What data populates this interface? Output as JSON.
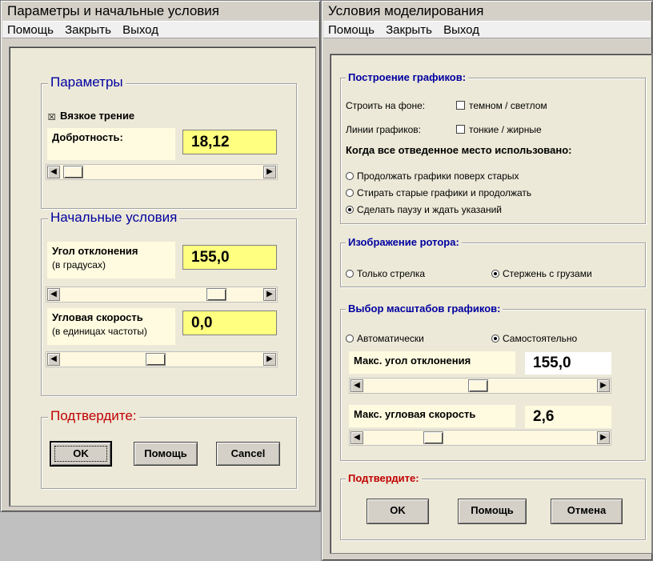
{
  "left": {
    "title": "Параметры и начальные условия",
    "menu": [
      "Помощь",
      "Закрыть",
      "Выход"
    ],
    "params": {
      "legend": "Параметры",
      "viscous_label": "Вязкое трение",
      "viscous_checked": true,
      "q_label": "Добротность:",
      "q_value": "18,12"
    },
    "initial": {
      "legend": "Начальные условия",
      "angle_label": "Угол отклонения",
      "angle_sub": "(в градусах)",
      "angle_value": "155,0",
      "speed_label": "Угловая скорость",
      "speed_sub": "(в единицах частоты)",
      "speed_value": "0,0"
    },
    "confirm": {
      "legend": "Подтвердите:",
      "ok": "OK",
      "help": "Помощь",
      "cancel": "Cancel"
    }
  },
  "right": {
    "title": "Условия моделирования",
    "menu": [
      "Помощь",
      "Закрыть",
      "Выход"
    ],
    "plots": {
      "legend": "Построение графиков:",
      "bg_label": "Строить на фоне:",
      "bg_option": "темном / светлом",
      "lines_label": "Линии графиков:",
      "lines_option": "тонкие /  жирные",
      "when_full": "Когда все отведенное место использовано:",
      "options": [
        {
          "label": "Продолжать графики поверх старых",
          "selected": false
        },
        {
          "label": "Стирать старые графики и продолжать",
          "selected": false
        },
        {
          "label": "Сделать паузу и ждать указаний",
          "selected": true
        }
      ]
    },
    "rotor": {
      "legend": "Изображение ротора:",
      "options": [
        {
          "label": "Только стрелка",
          "selected": false
        },
        {
          "label": "Стержень с грузами",
          "selected": true
        }
      ]
    },
    "scales": {
      "legend": "Выбор масштабов графиков:",
      "options": [
        {
          "label": "Автоматически",
          "selected": false
        },
        {
          "label": "Самостоятельно",
          "selected": true
        }
      ],
      "max_angle_label": "Макс. угол отклонения",
      "max_angle_value": "155,0",
      "max_speed_label": "Макс. угловая скорость",
      "max_speed_value": "2,6"
    },
    "confirm": {
      "legend": "Подтвердите:",
      "ok": "OK",
      "help": "Помощь",
      "cancel": "Отмена"
    }
  }
}
